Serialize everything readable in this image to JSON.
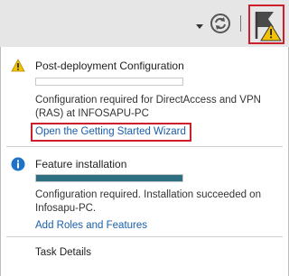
{
  "toolbar": {
    "dropdown_icon": "chevron-down-icon",
    "refresh_icon": "refresh-icon",
    "notifications_icon": "flag-warning-icon",
    "highlight_color": "#cc1f2b"
  },
  "notifications": [
    {
      "icon": "warning-icon",
      "title": "Post-deployment Configuration",
      "progress": 0,
      "description": "Configuration required for DirectAccess and VPN (RAS) at INFOSAPU-PC",
      "link": "Open the Getting Started Wizard"
    },
    {
      "icon": "info-icon",
      "title": "Feature installation",
      "progress": 1,
      "description": "Configuration required. Installation succeeded on Infosapu-PC.",
      "link": "Add Roles and Features"
    }
  ],
  "footer": {
    "task_details": "Task Details"
  },
  "colors": {
    "progress_fill": "#2e6f82",
    "link": "#1a5ea8",
    "warning": "#f2c200",
    "info": "#1e73c8"
  }
}
